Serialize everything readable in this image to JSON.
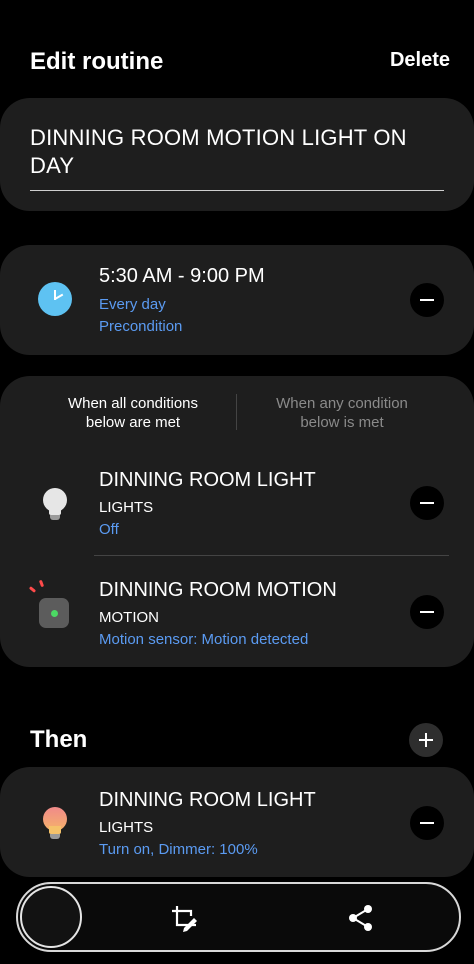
{
  "header": {
    "title": "Edit routine",
    "delete_label": "Delete"
  },
  "routine_name": "DINNING ROOM MOTION LIGHT ON DAY",
  "time_condition": {
    "icon": "clock-icon",
    "time_range": "5:30 AM - 9:00 PM",
    "repeat": "Every day",
    "type": "Precondition"
  },
  "conditions": {
    "mode_all": "When all conditions below are met",
    "mode_any": "When any condition below is met",
    "selected_mode": "all",
    "items": [
      {
        "icon": "lightbulb-icon",
        "device": "DINNING ROOM LIGHT",
        "category": "LIGHTS",
        "state": "Off"
      },
      {
        "icon": "motion-sensor-icon",
        "device": "DINNING ROOM  MOTION",
        "category": "MOTION",
        "state": "Motion sensor: Motion detected"
      }
    ]
  },
  "then": {
    "label": "Then",
    "actions": [
      {
        "icon": "lightbulb-on-icon",
        "device": "DINNING ROOM LIGHT",
        "category": "LIGHTS",
        "state": "Turn on, Dimmer: 100%"
      }
    ]
  },
  "bottom_bar": {
    "icons": [
      "home-button",
      "edit-icon",
      "share-icon"
    ]
  },
  "colors": {
    "background": "#000000",
    "card": "#1e1e1e",
    "accent_blue": "#5b9bf2",
    "clock_blue": "#5ec2f2",
    "sensor_led": "#4cd964",
    "bulb_on": "#f5a679"
  }
}
